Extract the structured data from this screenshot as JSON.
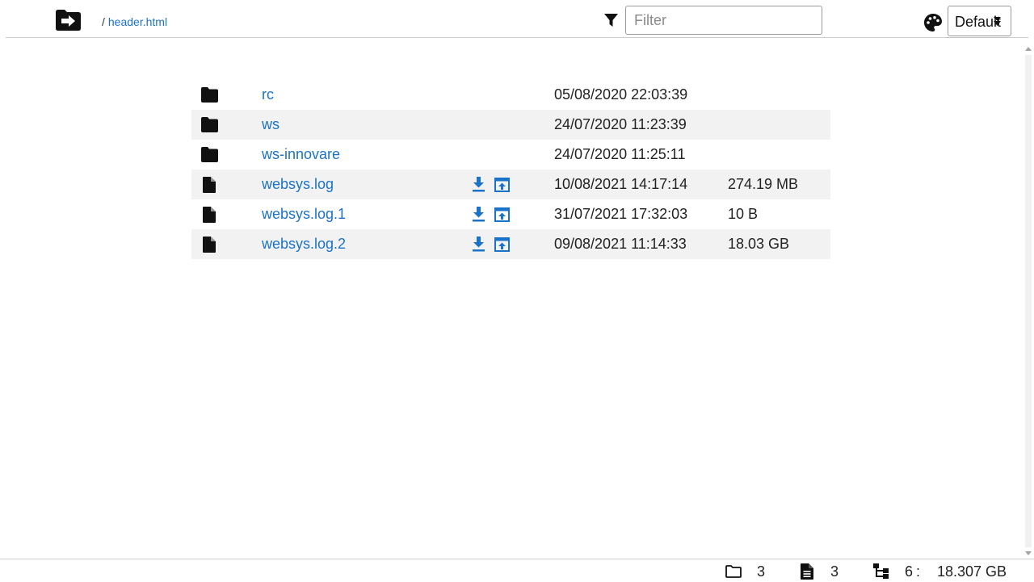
{
  "header": {
    "breadcrumb_separator": "/",
    "breadcrumb_current": "header.html",
    "filter_placeholder": "Filter",
    "filter_value": "",
    "theme_value": "Default"
  },
  "entries": [
    {
      "type": "folder",
      "name": "rc",
      "modified": "05/08/2020 22:03:39",
      "size": ""
    },
    {
      "type": "folder",
      "name": "ws",
      "modified": "24/07/2020 11:23:39",
      "size": ""
    },
    {
      "type": "folder",
      "name": "ws-innovare",
      "modified": "24/07/2020 11:25:11",
      "size": ""
    },
    {
      "type": "file",
      "name": "websys.log",
      "modified": "10/08/2021 14:17:14",
      "size": "274.19 MB"
    },
    {
      "type": "file",
      "name": "websys.log.1",
      "modified": "31/07/2021 17:32:03",
      "size": "10 B"
    },
    {
      "type": "file",
      "name": "websys.log.2",
      "modified": "09/08/2021 11:14:33",
      "size": "18.03 GB"
    }
  ],
  "footer": {
    "folder_count": "3",
    "file_count": "3",
    "total_count": "6",
    "colon": ":",
    "total_size": "18.307 GB"
  },
  "icons": {
    "home": "folder-arrow-icon",
    "filter": "filter-icon",
    "theme": "palette-icon",
    "folder": "folder-icon",
    "file": "file-icon",
    "download": "download-icon",
    "open": "open-in-window-icon",
    "tree": "tree-icon"
  },
  "colors": {
    "link": "#1a73c8",
    "row_alt": "#f2f2f2",
    "divider": "#cccccc"
  }
}
